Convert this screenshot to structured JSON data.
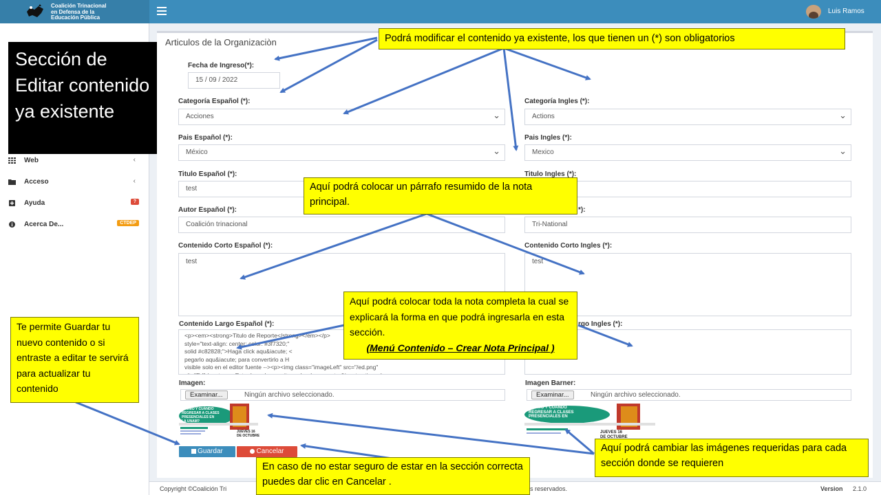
{
  "header": {
    "org_line1": "Coalición Trinacional",
    "org_line2": "en Defensa de la",
    "org_line3": "Educación Pública",
    "user_name": "Luis Ramos"
  },
  "sidebar": {
    "items": [
      {
        "label": "Web",
        "icon": "grid-icon"
      },
      {
        "label": "Acceso",
        "icon": "folder-icon"
      },
      {
        "label": "Ayuda",
        "icon": "plus-square-icon",
        "badge": "?"
      },
      {
        "label": "Acerca De...",
        "icon": "info-circle-icon",
        "badge": "CTDEP"
      }
    ],
    "badge_colors": {
      "ayuda": "#dd4b39",
      "acerca": "#f39c12"
    }
  },
  "form": {
    "title": "Articulos de la Organizaciòn",
    "fecha_label": "Fecha de Ingreso(*):",
    "fecha_value": "15 / 09 / 2022",
    "cat_es_label": "Categoría Español (*):",
    "cat_es_value": "Acciones",
    "cat_en_label": "Categoría Ingles (*):",
    "cat_en_value": "Actions",
    "pais_es_label": "Pais Español (*):",
    "pais_es_value": "México",
    "pais_en_label": "Pais Ingles (*):",
    "pais_en_value": "Mexico",
    "titulo_es_label": "Titulo Español (*):",
    "titulo_es_value": "test",
    "titulo_en_label": "Titulo Ingles (*):",
    "autor_es_label": "Autor Español (*):",
    "autor_es_value": "Coalición trinacional",
    "autor_en_label_visible": "*):",
    "autor_en_value": "Tri-National",
    "corto_es_label": "Contenido Corto Español (*):",
    "corto_es_value": "test",
    "corto_en_label": "Contenido Corto Ingles (*):",
    "corto_en_value": "test",
    "largo_es_label": "Contenido Largo Español (*):",
    "largo_es_value": "<p><em><strong>Titulo de Reporte</strong></em></p>\nstyle=\"text-align: center; color: #3f7320;\"\nsolid #c82828;\">Haga click aqu&iacute; <\npegarlo aqu&iacute; para convertirlo a H\nvisible solo en el editor fuente --><p><img class=\"imageLeft\" src=\"/ed.png\"\nalt=\"Ed\" /><strong>Este demo le permite probar las caracter&iacute;sticas de",
    "largo_en_label_visible": "rgo Ingles (*):",
    "imagen_label": "Imagen:",
    "imagen_banner_label": "Imagen Barner:",
    "file_button": "Examinar...",
    "file_none": "Ningún archivo seleccionado.",
    "thumb_line1": "¿CÓMO Y CUÁNDO",
    "thumb_line2": "REGRESAR A CLASES",
    "thumb_line3": "PRESENCIALES EN",
    "thumb_line4": "LA UNAM?",
    "thumb_date1": "JUEVES 16",
    "thumb_date2": "DE OCTUBRE",
    "save_label": "Guardar",
    "cancel_label": "Cancelar"
  },
  "footer": {
    "copyright": "Copyright ©Coalición Tri",
    "rights": "s reservados.",
    "version_label": "Version",
    "version": "2.1.0"
  },
  "callouts": {
    "section": "Sección de Editar contenido ya existente",
    "modify": "Podrá modificar el contenido ya existente, los que tienen un (*) son obligatorios",
    "summary": "Aquí podrá colocar un párrafo resumido de la nota principal.",
    "full_note": "Aquí podrá colocar toda la nota completa la cual se explicará la forma en que podrá ingresarla en esta sección.",
    "full_note_ref": "(Menú Contenido – Crear Nota Principal )",
    "save_help": "Te permite Guardar tu nuevo contenido o si entraste a editar te servirá para actualizar tu contenido",
    "images_help": "Aquí podrá cambiar las imágenes requeridas para cada sección donde se requieren",
    "cancel_help": "En caso de no estar seguro de estar en la sección correcta puedes dar clic en Cancelar ."
  },
  "colors": {
    "header": "#3c8dbc",
    "callout": "#ffff00",
    "arrow": "#4472c4",
    "save": "#3c8dbc",
    "cancel": "#dd4b39"
  }
}
